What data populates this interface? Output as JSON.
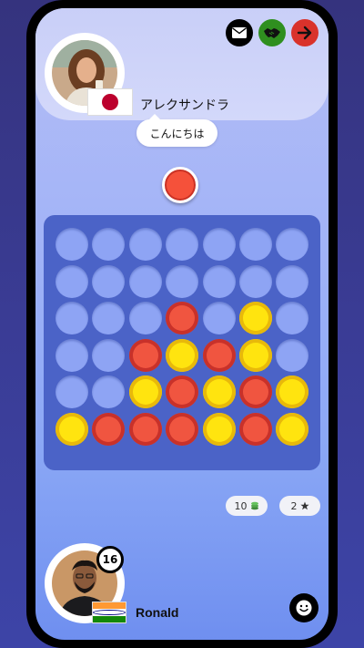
{
  "opponent": {
    "name": "アレクサンドラ",
    "flag": "japan-flag",
    "chat_message": "こんにちは"
  },
  "top_actions": [
    {
      "name": "mail-button",
      "icon": "envelope-icon",
      "color": "#000000"
    },
    {
      "name": "offer-draw-button",
      "icon": "handshake-icon",
      "color": "#2f8f1f"
    },
    {
      "name": "exit-button",
      "icon": "arrow-right-icon",
      "color": "#d9322b"
    }
  ],
  "current_turn_disc": "red",
  "board": {
    "rows": 6,
    "cols": 7,
    "grid": [
      [
        "empty",
        "empty",
        "empty",
        "empty",
        "empty",
        "empty",
        "empty"
      ],
      [
        "empty",
        "empty",
        "empty",
        "empty",
        "empty",
        "empty",
        "empty"
      ],
      [
        "empty",
        "empty",
        "empty",
        "red",
        "empty",
        "yellow",
        "empty"
      ],
      [
        "empty",
        "empty",
        "red",
        "yellow",
        "red",
        "yellow",
        "empty"
      ],
      [
        "empty",
        "empty",
        "yellow",
        "red",
        "yellow",
        "red",
        "yellow"
      ],
      [
        "yellow",
        "red",
        "red",
        "red",
        "yellow",
        "red",
        "yellow"
      ]
    ]
  },
  "stats": {
    "coins": "10",
    "coin_icon": "coins-icon",
    "stars": "2",
    "star_icon": "star-icon"
  },
  "player": {
    "name": "Ronald",
    "level": "16",
    "flag": "india-flag"
  },
  "emoji_button_icon": "smiley-icon",
  "colors": {
    "red_disc": "#f05540",
    "yellow_disc": "#ffe40f",
    "board": "#4b63c7",
    "empty_slot": "#8ea4f4"
  }
}
